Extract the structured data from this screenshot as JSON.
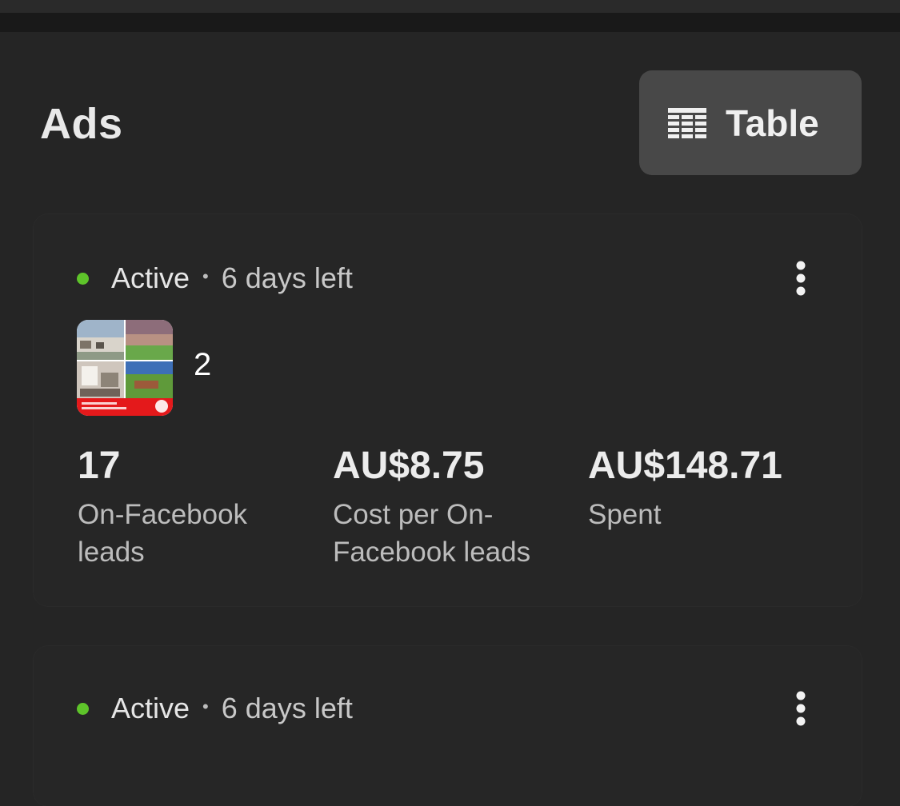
{
  "header": {
    "title": "Ads",
    "table_button_label": "Table"
  },
  "ads": [
    {
      "status": "Active",
      "separator": "•",
      "time_left": "6 days left",
      "creative_count": "2",
      "metrics": [
        {
          "value": "17",
          "label": "On-Facebook leads"
        },
        {
          "value": "AU$8.75",
          "label": "Cost per On-Facebook leads"
        },
        {
          "value": "AU$148.71",
          "label": "Spent"
        }
      ]
    },
    {
      "status": "Active",
      "separator": "•",
      "time_left": "6 days left"
    }
  ],
  "colors": {
    "background": "#252525",
    "status_active": "#5ec42a",
    "button_bg": "#484848"
  },
  "icons": {
    "table": "table-icon",
    "more": "more-vertical-icon"
  }
}
